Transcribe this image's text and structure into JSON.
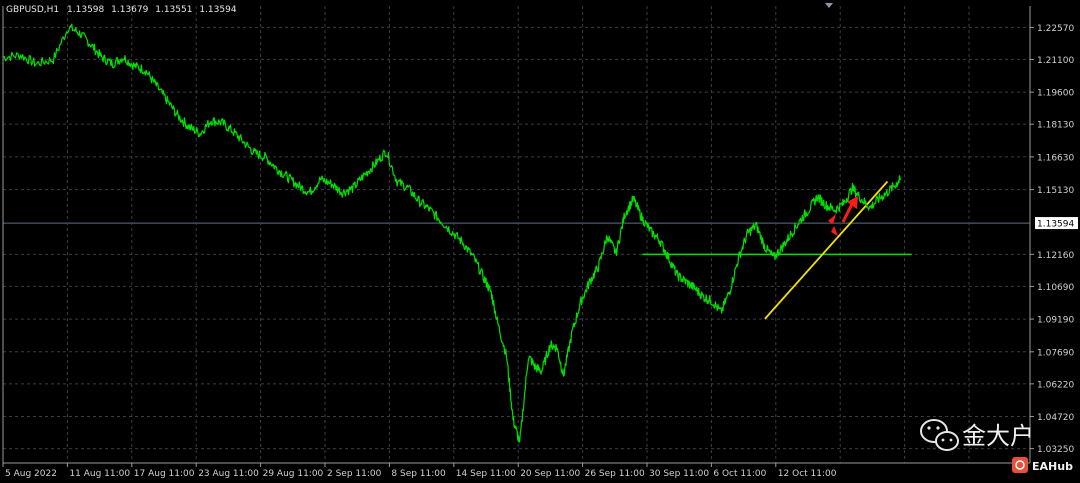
{
  "header": {
    "symbol": "GBPUSD,H1",
    "open": "1.13598",
    "high": "1.13679",
    "low": "1.13551",
    "close": "1.13594"
  },
  "chart_data": {
    "type": "line",
    "grid": true,
    "background": "#000000",
    "series_color": "#00e000",
    "ylim": [
      1.0259,
      1.2355
    ],
    "y_ticks": [
      "1.22570",
      "1.21100",
      "1.19600",
      "1.18130",
      "1.16630",
      "1.15130",
      "1.13594",
      "1.12160",
      "1.10690",
      "1.09190",
      "1.07690",
      "1.06220",
      "1.04720",
      "1.03250"
    ],
    "x_ticks": [
      "5 Aug 2022",
      "11 Aug 11:00",
      "17 Aug 11:00",
      "23 Aug 11:00",
      "29 Aug 11:00",
      "2 Sep 11:00",
      "8 Sep 11:00",
      "14 Sep 11:00",
      "20 Sep 11:00",
      "26 Sep 11:00",
      "30 Sep 11:00",
      "6 Oct 11:00",
      "12 Oct 11:00"
    ],
    "current_price": "1.13594",
    "current_price_value": 1.13594,
    "series": [
      {
        "x": [
          0,
          0.8,
          1.5,
          2.3,
          3.0,
          3.5,
          4.0,
          4.5,
          5.0,
          5.5,
          6.0,
          6.5,
          7.0,
          7.5,
          8.0,
          8.5,
          9.0,
          9.5,
          10.0,
          10.5,
          11.0,
          11.5,
          12.0,
          12.5,
          13.0,
          13.5,
          14.0,
          14.5,
          15.0,
          15.5,
          16.0,
          16.5,
          17.0,
          17.5,
          18.0,
          18.5,
          19.0,
          19.5,
          20.0,
          20.5,
          21.0,
          21.5,
          22.0,
          22.3,
          22.6,
          23.0,
          23.3,
          23.6,
          24.0,
          24.3,
          24.6,
          25.0,
          25.3,
          25.6,
          26.0,
          26.4,
          26.8,
          27.2,
          27.6,
          28.0,
          28.4,
          28.8,
          29.2,
          29.6,
          30.0,
          30.4,
          30.8,
          31.2,
          31.6,
          32.0,
          32.4,
          32.8,
          33.2,
          33.6,
          34.0,
          34.4,
          34.8,
          35.2,
          35.6,
          36.0,
          36.4,
          36.8,
          37.2,
          37.6,
          38.0,
          38.4,
          38.8,
          39.2,
          39.6,
          40.0,
          40.4,
          40.8,
          41.0
        ],
        "y": [
          1.212,
          1.213,
          1.209,
          1.211,
          1.226,
          1.223,
          1.218,
          1.212,
          1.209,
          1.212,
          1.208,
          1.206,
          1.199,
          1.192,
          1.185,
          1.18,
          1.177,
          1.183,
          1.182,
          1.178,
          1.173,
          1.168,
          1.166,
          1.161,
          1.157,
          1.153,
          1.15,
          1.156,
          1.154,
          1.15,
          1.152,
          1.158,
          1.163,
          1.169,
          1.155,
          1.152,
          1.146,
          1.142,
          1.137,
          1.132,
          1.127,
          1.12,
          1.11,
          1.104,
          1.09,
          1.075,
          1.046,
          1.035,
          1.075,
          1.07,
          1.068,
          1.08,
          1.079,
          1.066,
          1.086,
          1.1,
          1.109,
          1.116,
          1.13,
          1.122,
          1.14,
          1.147,
          1.138,
          1.132,
          1.128,
          1.12,
          1.112,
          1.109,
          1.106,
          1.102,
          1.1,
          1.095,
          1.105,
          1.12,
          1.131,
          1.135,
          1.125,
          1.12,
          1.125,
          1.131,
          1.137,
          1.142,
          1.148,
          1.144,
          1.142,
          1.145,
          1.152,
          1.147,
          1.143,
          1.147,
          1.15,
          1.154,
          1.156
        ],
        "xlim": [
          0,
          41.2
        ]
      }
    ],
    "annotations": [
      {
        "type": "horizontal_line",
        "color": "#00e000",
        "y": 1.1216,
        "x_start": 29.2,
        "x_end": 41.5
      },
      {
        "type": "trend_line",
        "color": "#f5e000",
        "x1": 34.8,
        "y1": 1.092,
        "x2": 40.4,
        "y2": 1.155
      },
      {
        "type": "arrow",
        "color": "#ff1a1a",
        "direction": "up"
      }
    ]
  },
  "watermark": {
    "name": "金大户",
    "badge": "EAHub"
  },
  "colors": {
    "grid": "#3c3c46",
    "axis": "#9a9a9a",
    "price_tag_bg": "#ffffff",
    "current_price_line": "#607080"
  }
}
